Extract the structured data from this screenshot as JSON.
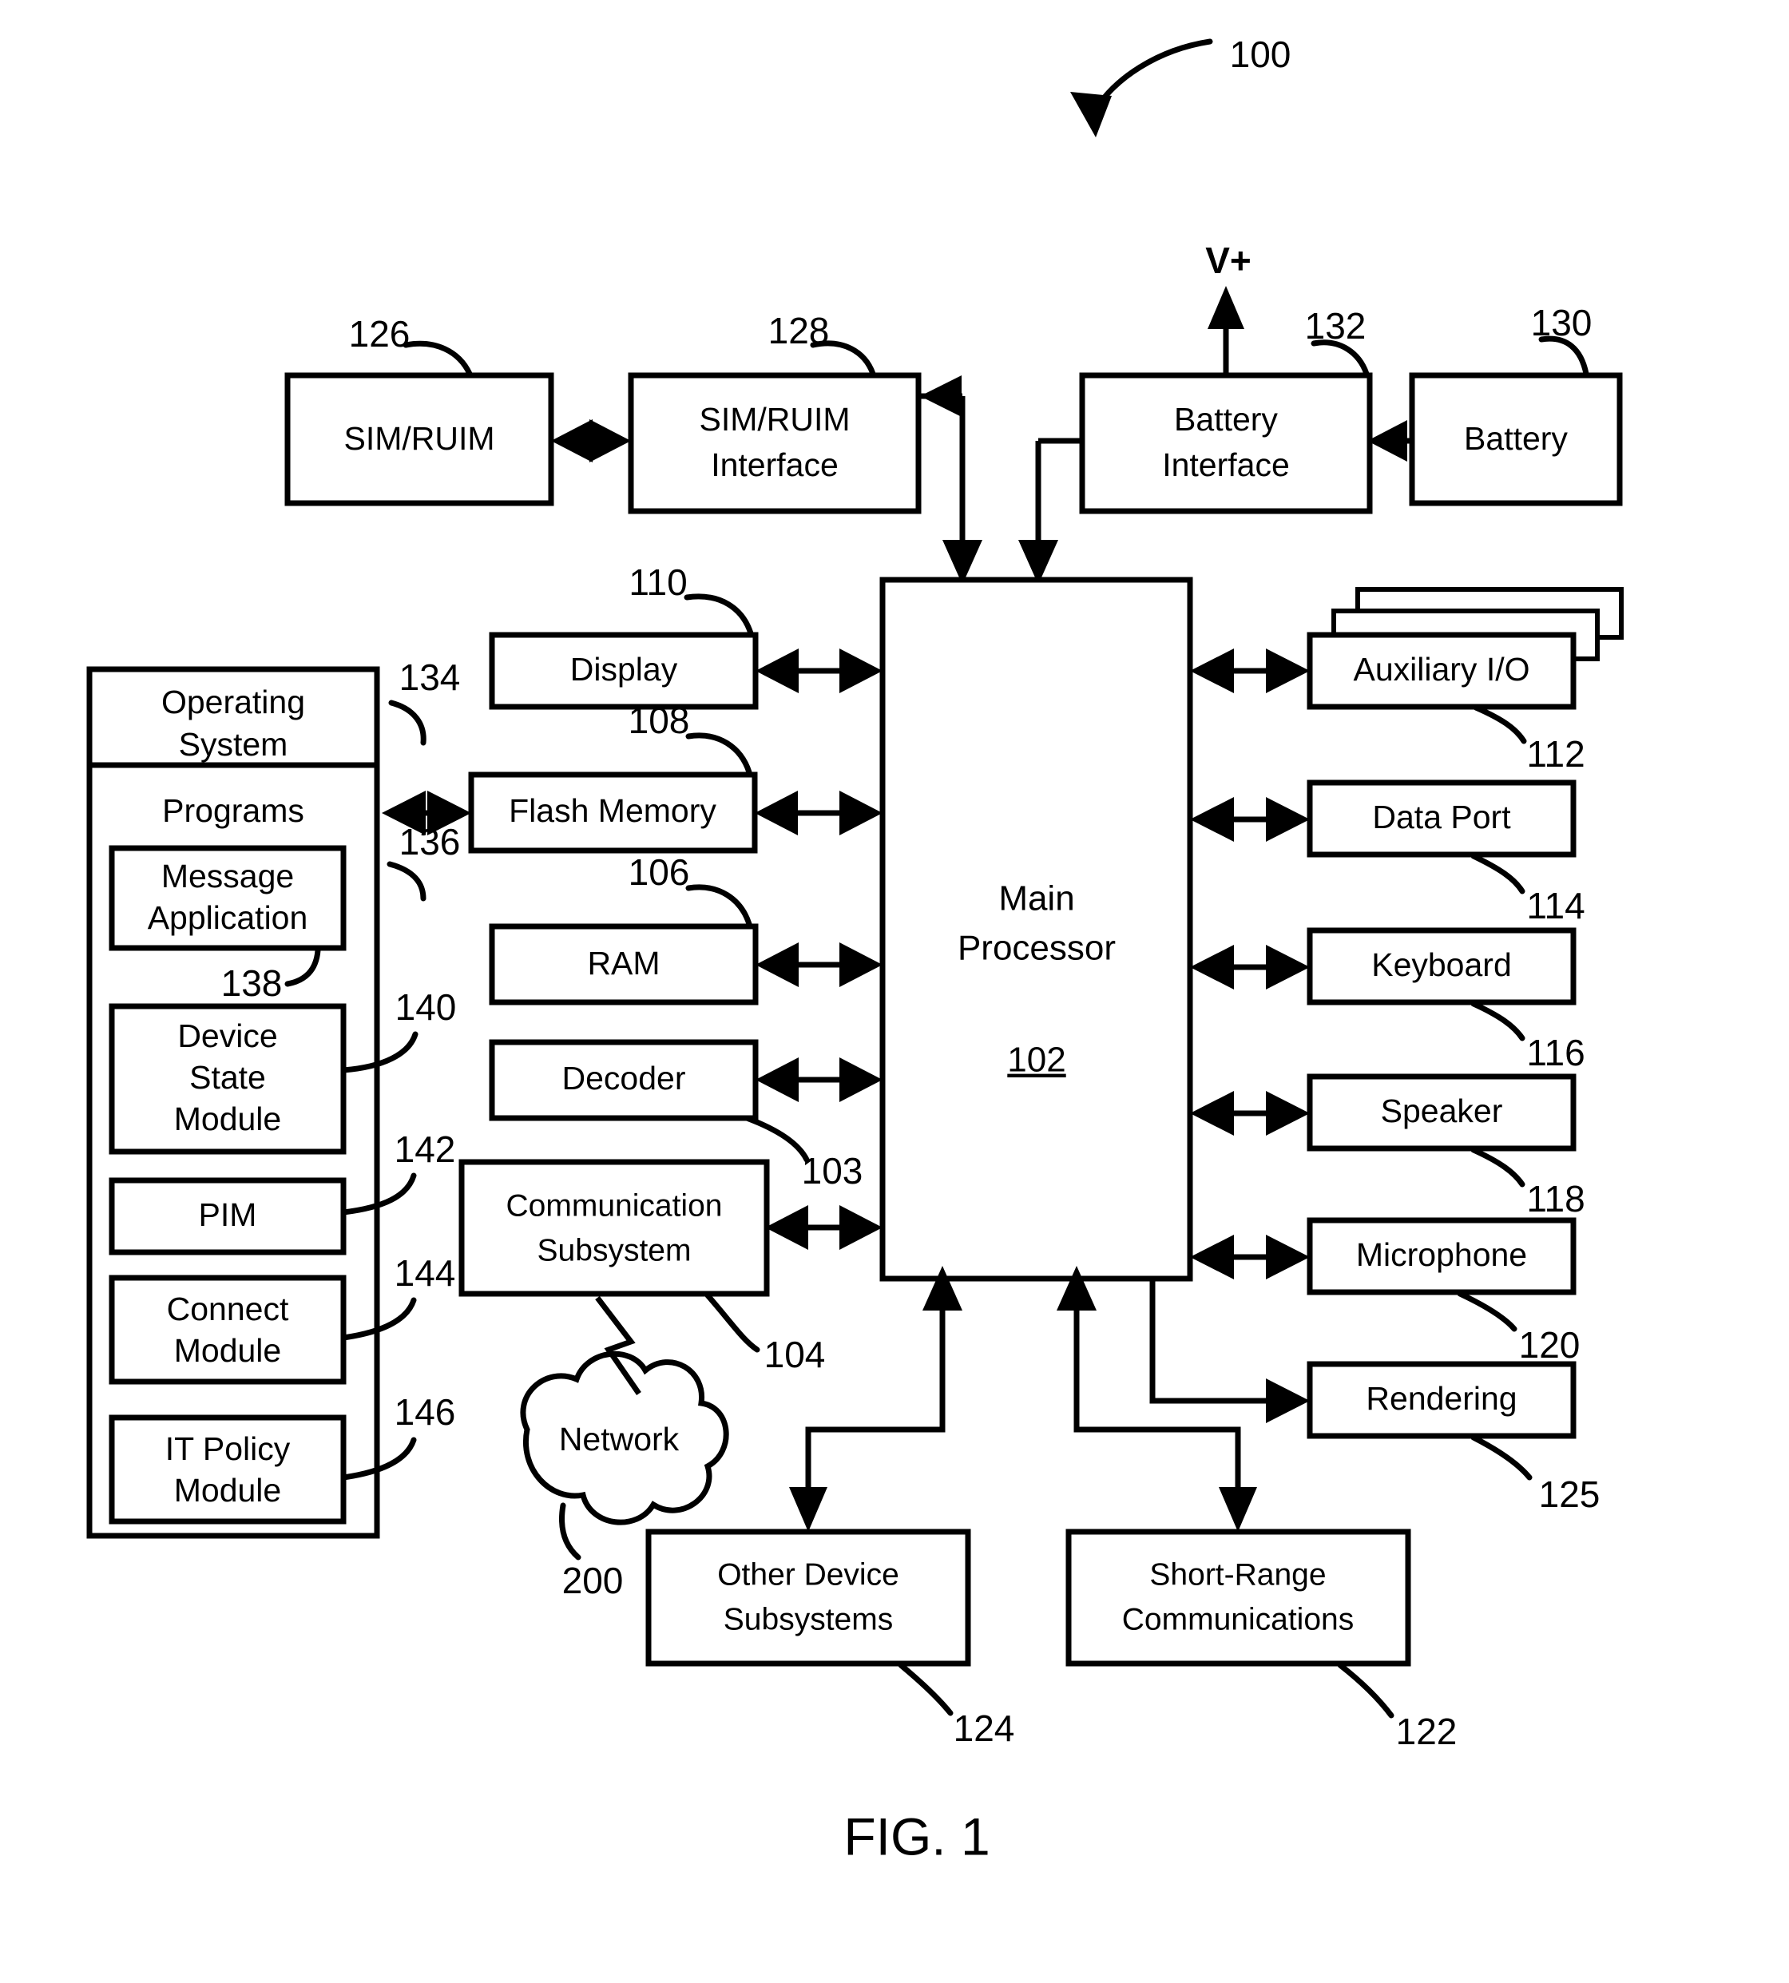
{
  "figure": {
    "caption": "FIG. 1",
    "system_ref": "100",
    "vplus_label": "V+"
  },
  "blocks": {
    "sim_ruim": {
      "label": "SIM/RUIM",
      "ref": "126"
    },
    "sim_ruim_interface": {
      "label_line1": "SIM/RUIM",
      "label_line2": "Interface",
      "ref": "128"
    },
    "battery_interface": {
      "label_line1": "Battery",
      "label_line2": "Interface",
      "ref": "132"
    },
    "battery": {
      "label": "Battery",
      "ref": "130"
    },
    "main_processor": {
      "label_line1": "Main",
      "label_line2": "Processor",
      "ref": "102"
    },
    "display": {
      "label": "Display",
      "ref": "110"
    },
    "flash_memory": {
      "label": "Flash Memory",
      "ref": "108"
    },
    "ram": {
      "label": "RAM",
      "ref": "106"
    },
    "decoder": {
      "label": "Decoder",
      "ref": "103"
    },
    "communication_subsystem": {
      "label_line1": "Communication",
      "label_line2": "Subsystem",
      "ref": "104"
    },
    "network": {
      "label": "Network",
      "ref": "200"
    },
    "auxiliary_io": {
      "label": "Auxiliary I/O",
      "ref": "112"
    },
    "data_port": {
      "label": "Data Port",
      "ref": "114"
    },
    "keyboard": {
      "label": "Keyboard",
      "ref": "116"
    },
    "speaker": {
      "label": "Speaker",
      "ref": "118"
    },
    "microphone": {
      "label": "Microphone",
      "ref": "120"
    },
    "rendering": {
      "label": "Rendering",
      "ref": "125"
    },
    "other_device_subsystems": {
      "label_line1": "Other Device",
      "label_line2": "Subsystems",
      "ref": "124"
    },
    "short_range_communications": {
      "label_line1": "Short-Range",
      "label_line2": "Communications",
      "ref": "122"
    }
  },
  "memory": {
    "operating_system": {
      "label_line1": "Operating",
      "label_line2": "System",
      "ref": "134"
    },
    "programs": {
      "label": "Programs",
      "ref": "136"
    },
    "message_application": {
      "label_line1": "Message",
      "label_line2": "Application",
      "ref": "138"
    },
    "device_state_module": {
      "label_line1": "Device",
      "label_line2": "State",
      "label_line3": "Module",
      "ref": "140"
    },
    "pim": {
      "label": "PIM",
      "ref": "142"
    },
    "connect_module": {
      "label_line1": "Connect",
      "label_line2": "Module",
      "ref": "144"
    },
    "it_policy_module": {
      "label_line1": "IT Policy",
      "label_line2": "Module",
      "ref": "146"
    }
  }
}
